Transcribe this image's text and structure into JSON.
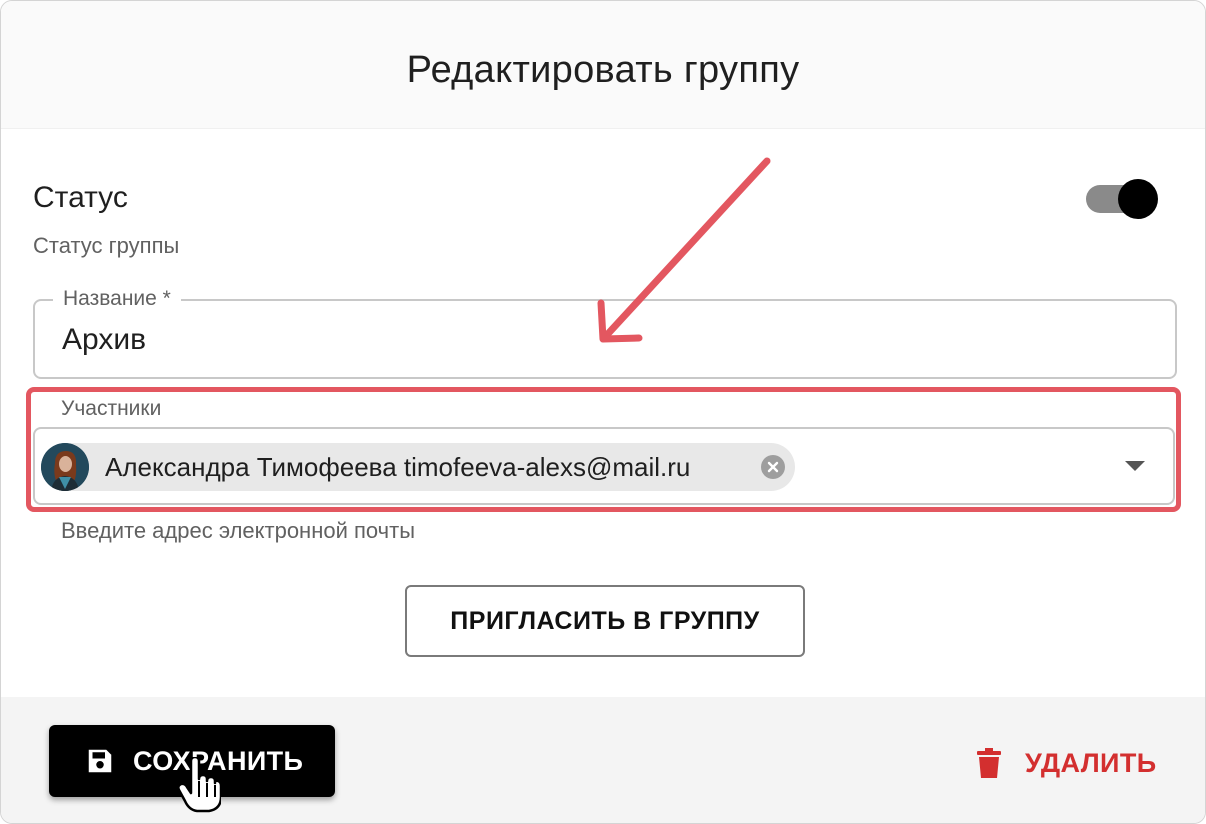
{
  "dialog": {
    "title": "Редактировать группу"
  },
  "status": {
    "label": "Статус",
    "description": "Статус группы",
    "enabled": true
  },
  "name_field": {
    "label": "Название *",
    "value": "Архив"
  },
  "members_field": {
    "label": "Участники",
    "chips": [
      {
        "text": "Александра Тимофеева timofeeva-alexs@mail.ru"
      }
    ],
    "helper": "Введите адрес электронной почты"
  },
  "invite_button": {
    "label": "ПРИГЛАСИТЬ В ГРУППУ"
  },
  "footer": {
    "save_label": "СОХРАНИТЬ",
    "delete_label": "УДАЛИТЬ"
  },
  "colors": {
    "annotation": "#e35760",
    "danger": "#d32f2f",
    "primary": "#000000"
  },
  "icons": {
    "save": "floppy-disk-icon",
    "delete": "trash-icon",
    "chip_close": "close-circle-icon",
    "dropdown": "chevron-down-icon",
    "cursor": "hand-pointer-icon"
  }
}
